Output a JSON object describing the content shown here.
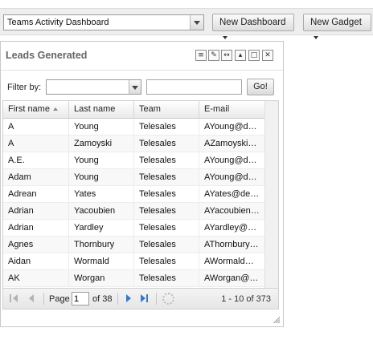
{
  "toolbar": {
    "dashboard_select_value": "Teams Activity Dashboard",
    "new_dashboard_label": "New Dashboard",
    "new_gadget_label": "New Gadget"
  },
  "gadget": {
    "title": "Leads Generated",
    "header_icons": [
      "edit-icon",
      "pencil-icon",
      "settings-icon",
      "collapse-icon",
      "maximize-icon",
      "close-icon"
    ],
    "filter": {
      "label": "Filter by:",
      "field_value": "",
      "text_value": "",
      "go_label": "Go!"
    },
    "grid": {
      "columns": [
        "First name",
        "Last name",
        "Team",
        "E-mail"
      ],
      "sort_column": "First name",
      "rows": [
        [
          "A",
          "Young",
          "Telesales",
          "AYoung@d…"
        ],
        [
          "A",
          "Zamoyski",
          "Telesales",
          "AZamoyski…"
        ],
        [
          "A.E.",
          "Young",
          "Telesales",
          "AYoung@d…"
        ],
        [
          "Adam",
          "Young",
          "Telesales",
          "AYoung@d…"
        ],
        [
          "Adrean",
          "Yates",
          "Telesales",
          "AYates@de…"
        ],
        [
          "Adrian",
          "Yacoubien",
          "Telesales",
          "AYacoubien…"
        ],
        [
          "Adrian",
          "Yardley",
          "Telesales",
          "AYardley@…"
        ],
        [
          "Agnes",
          "Thornbury",
          "Telesales",
          "AThornbury…"
        ],
        [
          "Aidan",
          "Wormald",
          "Telesales",
          "AWormald…"
        ],
        [
          "AK",
          "Worgan",
          "Telesales",
          "AWorgan@…"
        ]
      ]
    },
    "pager": {
      "page_label": "Page",
      "current_page": "1",
      "of_label": "of 38",
      "info": "1 - 10 of 373"
    }
  }
}
